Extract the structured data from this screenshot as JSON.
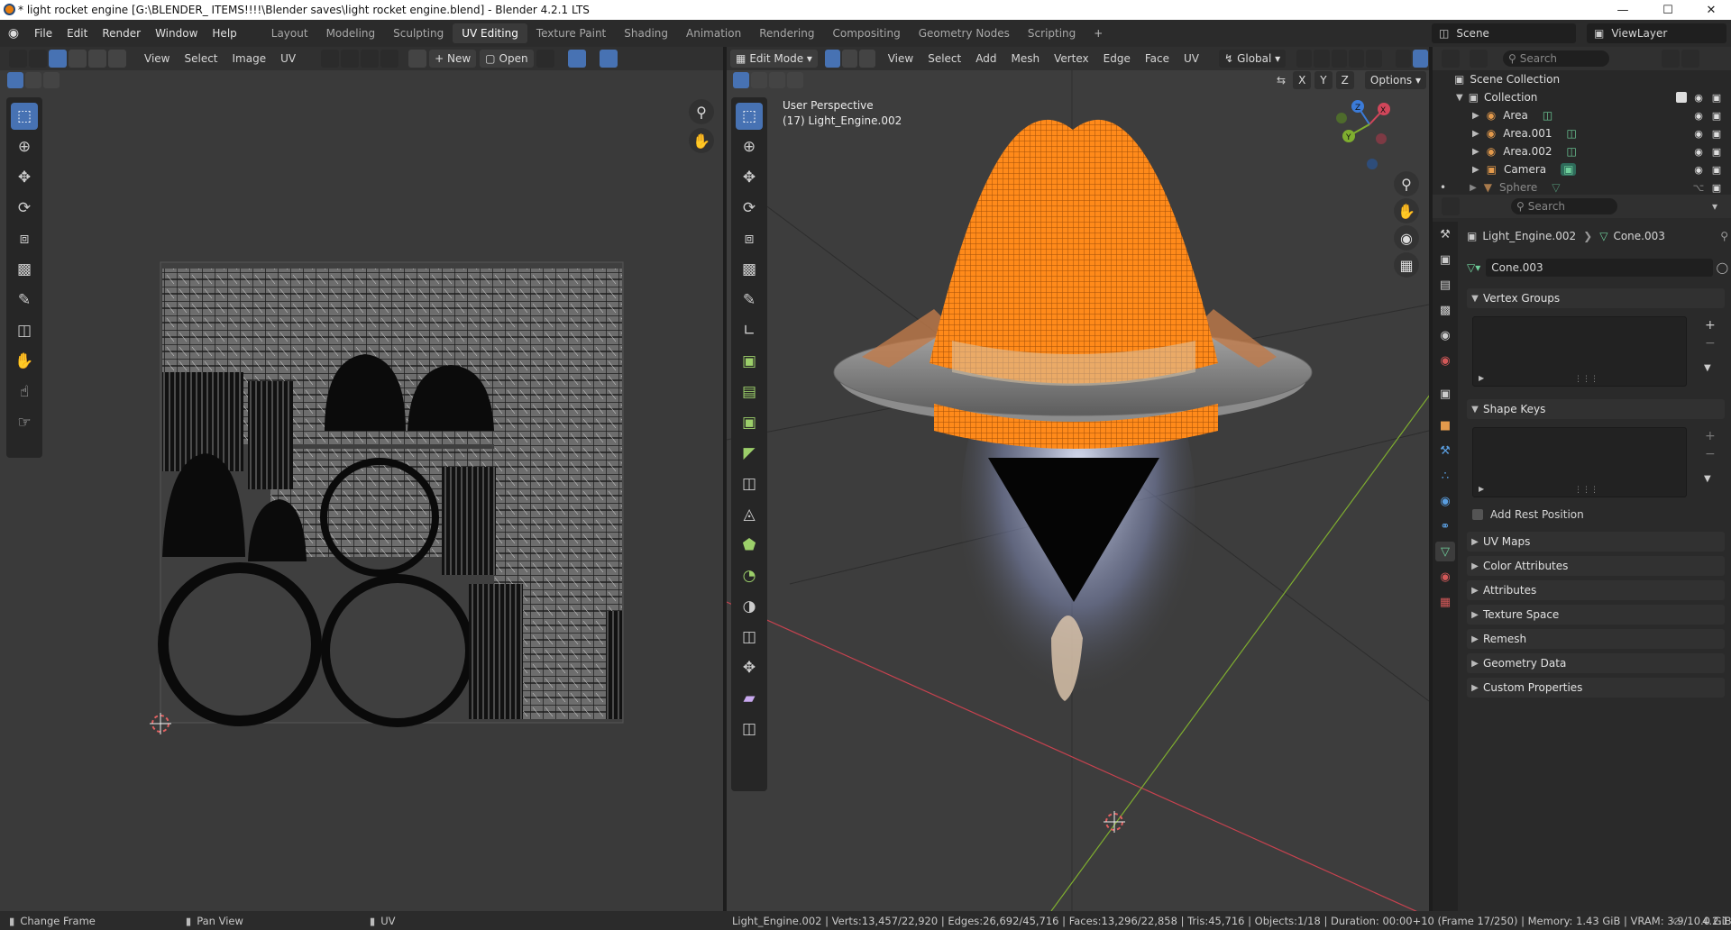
{
  "window": {
    "title": "* light rocket engine [G:\\BLENDER_ ITEMS!!!!\\Blender saves\\light rocket engine.blend] - Blender 4.2.1 LTS",
    "minimize": "—",
    "maximize": "☐",
    "close": "✕"
  },
  "menu": [
    "File",
    "Edit",
    "Render",
    "Window",
    "Help"
  ],
  "workspaces": [
    "Layout",
    "Modeling",
    "Sculpting",
    "UV Editing",
    "Texture Paint",
    "Shading",
    "Animation",
    "Rendering",
    "Compositing",
    "Geometry Nodes",
    "Scripting"
  ],
  "active_workspace": "UV Editing",
  "scene": {
    "name": "Scene",
    "view_layer": "ViewLayer"
  },
  "uv_editor": {
    "menus": [
      "View",
      "Select",
      "Image",
      "UV"
    ],
    "new_label": "New",
    "open_label": "Open"
  },
  "viewport": {
    "mode": "Edit Mode",
    "menus": [
      "View",
      "Select",
      "Add",
      "Mesh",
      "Vertex",
      "Edge",
      "Face",
      "UV"
    ],
    "orientation": "Global",
    "options_label": "Options",
    "axis_labels": [
      "X",
      "Y",
      "Z"
    ],
    "overlay_line1": "User Perspective",
    "overlay_line2": "(17) Light_Engine.002",
    "gizmo": {
      "x": "X",
      "y": "Y",
      "z": "Z"
    }
  },
  "outliner": {
    "search_placeholder": "Search",
    "root": "Scene Collection",
    "collection": "Collection",
    "items": [
      {
        "name": "Area"
      },
      {
        "name": "Area.001"
      },
      {
        "name": "Area.002"
      },
      {
        "name": "Camera"
      },
      {
        "name": "Sphere"
      }
    ]
  },
  "properties": {
    "search_placeholder": "Search",
    "breadcrumb_object": "Light_Engine.002",
    "breadcrumb_mesh": "Cone.003",
    "mesh_name": "Cone.003",
    "vertex_groups": "Vertex Groups",
    "shape_keys": "Shape Keys",
    "add_rest_position": "Add Rest Position",
    "collapsed_sections": [
      "UV Maps",
      "Color Attributes",
      "Attributes",
      "Texture Space",
      "Remesh",
      "Geometry Data",
      "Custom Properties"
    ]
  },
  "statusbar": {
    "left1": "Change Frame",
    "left2": "Pan View",
    "left3": "UV",
    "stats": "Light_Engine.002 | Verts:13,457/22,920 | Edges:26,692/45,716 | Faces:13,296/22,858 | Tris:45,716 | Objects:1/18 | Duration: 00:00+10 (Frame 17/250) | Memory: 1.43 GiB | VRAM: 3.9/10.0 GiB",
    "version": "4.2.1"
  },
  "colors": {
    "accent": "#4772b3",
    "selection_orange": "#ff8a1a",
    "x_axis": "#d0465a",
    "y_axis": "#7fae2f",
    "z_axis": "#3b7bd8"
  }
}
